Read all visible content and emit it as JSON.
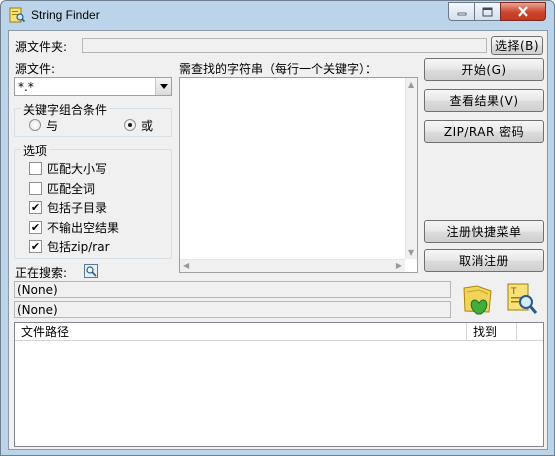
{
  "window": {
    "title": "String Finder"
  },
  "caption_buttons": {
    "minimize": "▬",
    "maximize": "▢",
    "close": "✕"
  },
  "source_folder": {
    "label": "源文件夹:",
    "value": "",
    "browse_button": "选择(B)"
  },
  "source_file": {
    "label": "源文件:",
    "value": "*.*"
  },
  "keywords": {
    "label": "需查找的字符串（每行一个关键字）：",
    "value": ""
  },
  "keyword_condition": {
    "title": "关键字组合条件",
    "options": [
      "与",
      "或"
    ],
    "selected": "或"
  },
  "options_group": {
    "title": "选项",
    "items": [
      {
        "label": "匹配大小写",
        "checked": false
      },
      {
        "label": "匹配全词",
        "checked": false
      },
      {
        "label": "包括子目录",
        "checked": true
      },
      {
        "label": "不输出空结果",
        "checked": true
      },
      {
        "label": "包括zip/rar",
        "checked": true
      }
    ]
  },
  "buttons": {
    "start": "开始(G)",
    "view_results": "查看结果(V)",
    "zip_password": "ZIP/RAR 密码",
    "register_menu": "注册快捷菜单",
    "unregister": "取消注册"
  },
  "status": {
    "searching_label": "正在搜索:",
    "line1": "(None)",
    "line2": "(None)"
  },
  "results_table": {
    "columns": [
      "文件路径",
      "找到"
    ],
    "rows": []
  }
}
